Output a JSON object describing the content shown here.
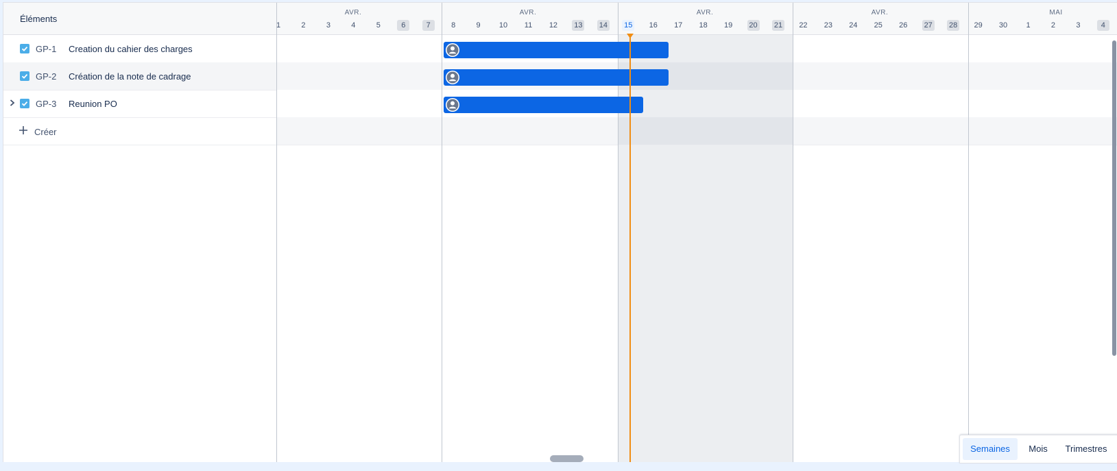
{
  "left_panel": {
    "header_label": "Éléments",
    "items": [
      {
        "key": "GP-1",
        "summary": "Creation du cahier des charges",
        "expandable": false
      },
      {
        "key": "GP-2",
        "summary": "Création de la note de cadrage",
        "expandable": false
      },
      {
        "key": "GP-3",
        "summary": "Reunion PO",
        "expandable": true
      }
    ],
    "create_label": "Créer"
  },
  "timeline": {
    "months": [
      "AVR.",
      "AVR.",
      "AVR.",
      "AVR.",
      "MAI"
    ],
    "days": [
      "1",
      "2",
      "3",
      "4",
      "5",
      "6",
      "7",
      "8",
      "9",
      "10",
      "11",
      "12",
      "13",
      "14",
      "15",
      "16",
      "17",
      "18",
      "19",
      "20",
      "21",
      "22",
      "23",
      "24",
      "25",
      "26",
      "27",
      "28",
      "29",
      "30",
      "1",
      "2",
      "3",
      "4"
    ],
    "weekend_days": [
      "6",
      "7",
      "13",
      "14",
      "20",
      "21",
      "27",
      "28",
      "4"
    ],
    "today": "15",
    "bars": [
      {
        "key": "GP-1",
        "start": "Apr 8",
        "end": "Apr 16"
      },
      {
        "key": "GP-2",
        "start": "Apr 8",
        "end": "Apr 16"
      },
      {
        "key": "GP-3",
        "start": "Apr 8",
        "end": "Apr 15"
      }
    ]
  },
  "view_switcher": {
    "options": [
      "Semaines",
      "Mois",
      "Trimestres"
    ],
    "selected": "Semaines"
  },
  "colors": {
    "bar": "#0c66e4",
    "today_line": "#f18d13",
    "checkbox": "#4bade8",
    "weekend_shade": "#dcdfe4"
  },
  "icons": {
    "checkbox": "task-checkbox-icon",
    "expand": "chevron-right-icon",
    "create": "plus-icon",
    "avatar": "user-avatar-icon"
  }
}
